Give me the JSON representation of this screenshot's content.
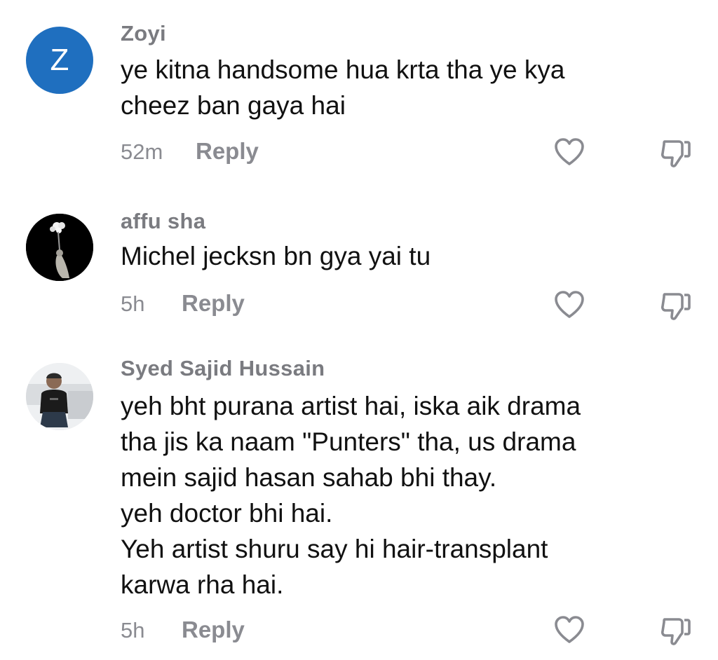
{
  "comments": [
    {
      "avatar_letter": "Z",
      "username": "Zoyi",
      "text": "ye kitna handsome hua krta tha ye kya\ncheez ban gaya hai",
      "time": "52m",
      "reply_label": "Reply",
      "avatar_icon": "letter-avatar"
    },
    {
      "username": "affu sha",
      "text": "Michel jecksn bn gya yai tu",
      "time": "5h",
      "reply_label": "Reply",
      "avatar_icon": "photo-avatar-dark"
    },
    {
      "username": "Syed Sajid Hussain",
      "text": "yeh bht purana artist hai, iska aik drama\ntha jis ka naam \"Punters\" tha, us drama\nmein sajid hasan sahab bhi thay.\nyeh doctor bhi hai.\nYeh artist shuru say hi hair-transplant\nkarwa rha hai.",
      "time": "5h",
      "reply_label": "Reply",
      "avatar_icon": "photo-avatar"
    }
  ],
  "icons": {
    "like": "heart-outline-icon",
    "dislike": "thumbs-down-outline-icon"
  },
  "colors": {
    "avatar_blue": "#1f6fbf",
    "muted_text": "#8a8b91",
    "body_text": "#111111"
  }
}
